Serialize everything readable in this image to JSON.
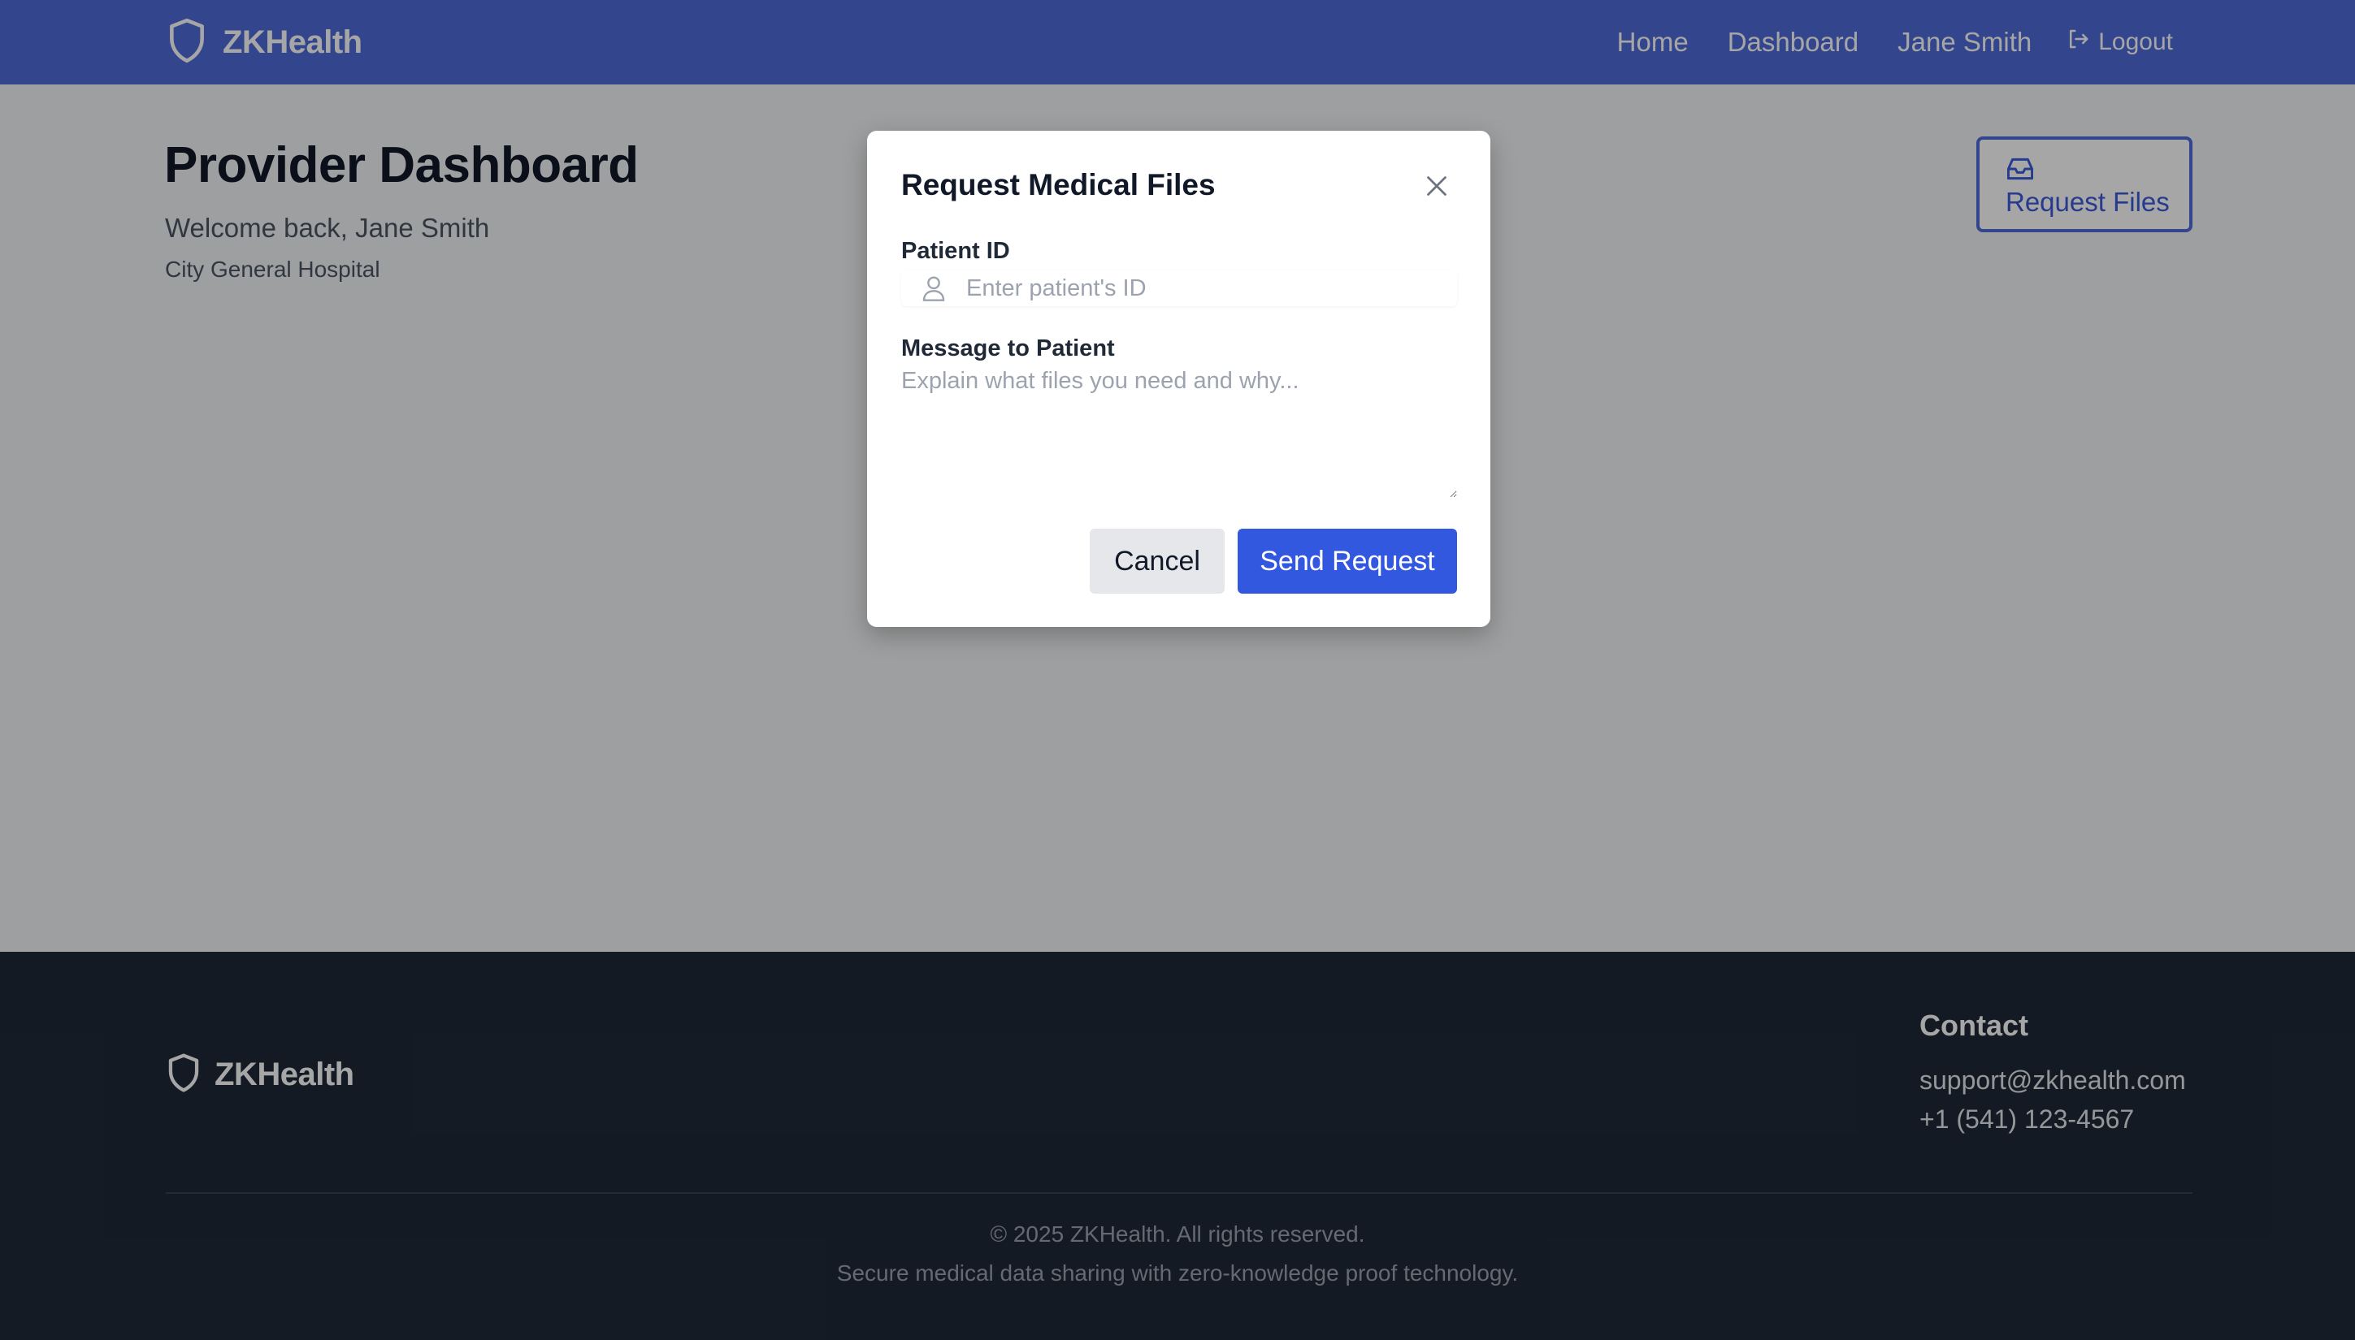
{
  "navbar": {
    "brand": "ZKHealth",
    "links": [
      "Home",
      "Dashboard",
      "Jane Smith"
    ],
    "logout_label": "Logout"
  },
  "dashboard": {
    "title": "Provider Dashboard",
    "welcome": "Welcome back, Jane Smith",
    "hospital": "City General Hospital",
    "request_button_label": "Request Files"
  },
  "modal": {
    "title": "Request Medical Files",
    "patient_id_label": "Patient ID",
    "patient_id_placeholder": "Enter patient's ID",
    "patient_id_value": "",
    "message_label": "Message to Patient",
    "message_placeholder": "Explain what files you need and why...",
    "message_value": "",
    "cancel_label": "Cancel",
    "send_label": "Send Request"
  },
  "footer": {
    "brand": "ZKHealth",
    "contact_heading": "Contact",
    "email": "support@zkhealth.com",
    "phone": "+1 (541) 123-4567",
    "copyright": "© 2025 ZKHealth. All rights reserved.",
    "tagline": "Secure medical data sharing with zero-knowledge proof technology."
  },
  "icons": {
    "brand": "shield-icon",
    "logout": "logout-icon",
    "request_files": "inbox-icon",
    "close": "close-icon",
    "patient": "user-icon"
  },
  "colors": {
    "primary": "#4f6ad8",
    "button_primary": "#3358e0",
    "footer_bg": "#1f2937",
    "page_bg": "#f3f4f6"
  }
}
